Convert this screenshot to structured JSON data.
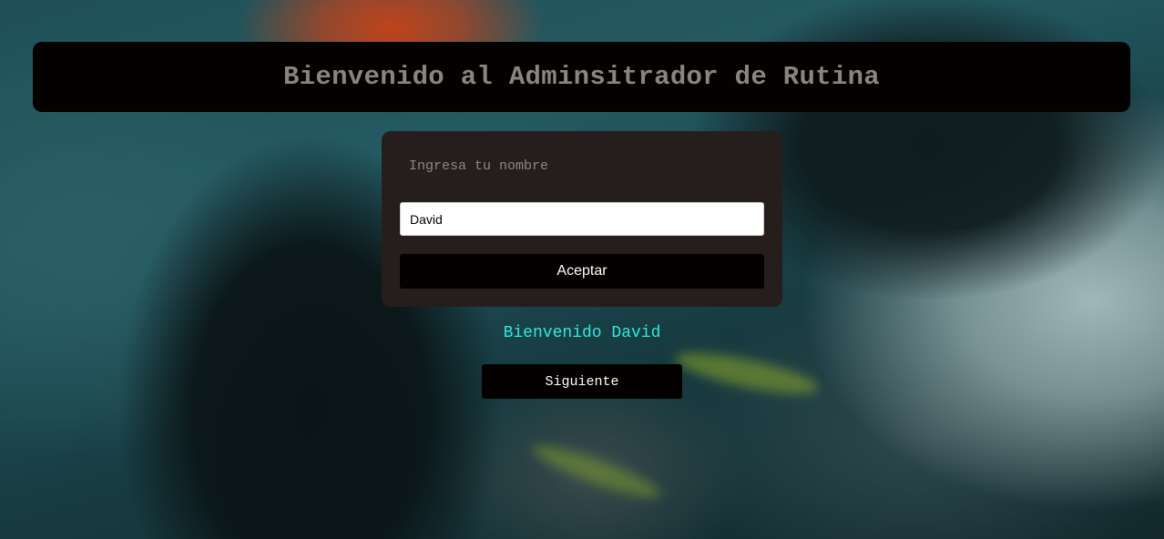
{
  "header": {
    "title": "Bienvenido al Adminsitrador de Rutina"
  },
  "form": {
    "label": "Ingresa tu nombre",
    "name_value": "David",
    "accept_label": "Aceptar"
  },
  "welcome": {
    "message": "Bienvenido David"
  },
  "navigation": {
    "next_label": "Siguiente"
  },
  "colors": {
    "header_bg": "#040101",
    "card_bg": "#261e1d",
    "welcome_text": "#31e8dc",
    "button_bg": "#050101"
  }
}
